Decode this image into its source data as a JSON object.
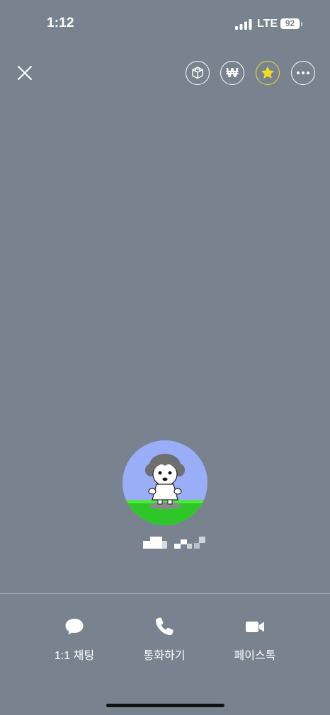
{
  "status_bar": {
    "time": "1:12",
    "network": "LTE",
    "battery": "92"
  },
  "top_actions": {
    "close_icon": "close-icon",
    "gift_icon": "gift-box-icon",
    "won_symbol": "₩",
    "favorite_icon": "star-icon",
    "more_icon": "more-horizontal-icon"
  },
  "colors": {
    "background": "#78838f",
    "favorite_accent": "#f4dd1c"
  },
  "profile": {
    "avatar_icon": "profile-character-avatar"
  },
  "bottom_actions": [
    {
      "label": "1:1 채팅",
      "icon": "chat-bubble-icon"
    },
    {
      "label": "통화하기",
      "icon": "phone-icon"
    },
    {
      "label": "페이스톡",
      "icon": "video-camera-icon"
    }
  ]
}
